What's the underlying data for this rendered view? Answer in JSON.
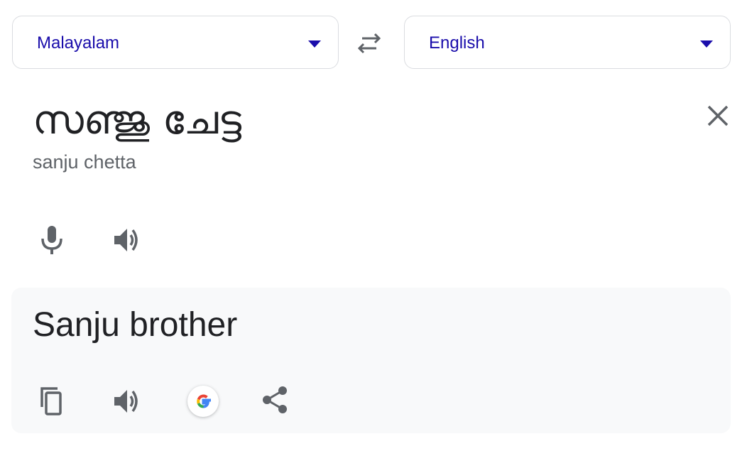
{
  "source_language": {
    "label": "Malayalam",
    "icon": "dropdown-arrow-icon"
  },
  "target_language": {
    "label": "English",
    "icon": "dropdown-arrow-icon"
  },
  "swap": {
    "icon": "swap-arrows-icon"
  },
  "source": {
    "text": "സഞ്ജു ചേട്ട",
    "transliteration": "sanju chetta",
    "clear_icon": "close-icon",
    "mic_icon": "microphone-icon",
    "listen_icon": "speaker-icon"
  },
  "result": {
    "text": "Sanju brother",
    "copy_icon": "copy-icon",
    "listen_icon": "speaker-icon",
    "google_icon": "google-logo-icon",
    "share_icon": "share-icon"
  },
  "colors": {
    "link_blue": "#1a0dab",
    "icon_gray": "#5f6368",
    "panel_bg": "#f8f9fa",
    "border": "#dadce0"
  }
}
